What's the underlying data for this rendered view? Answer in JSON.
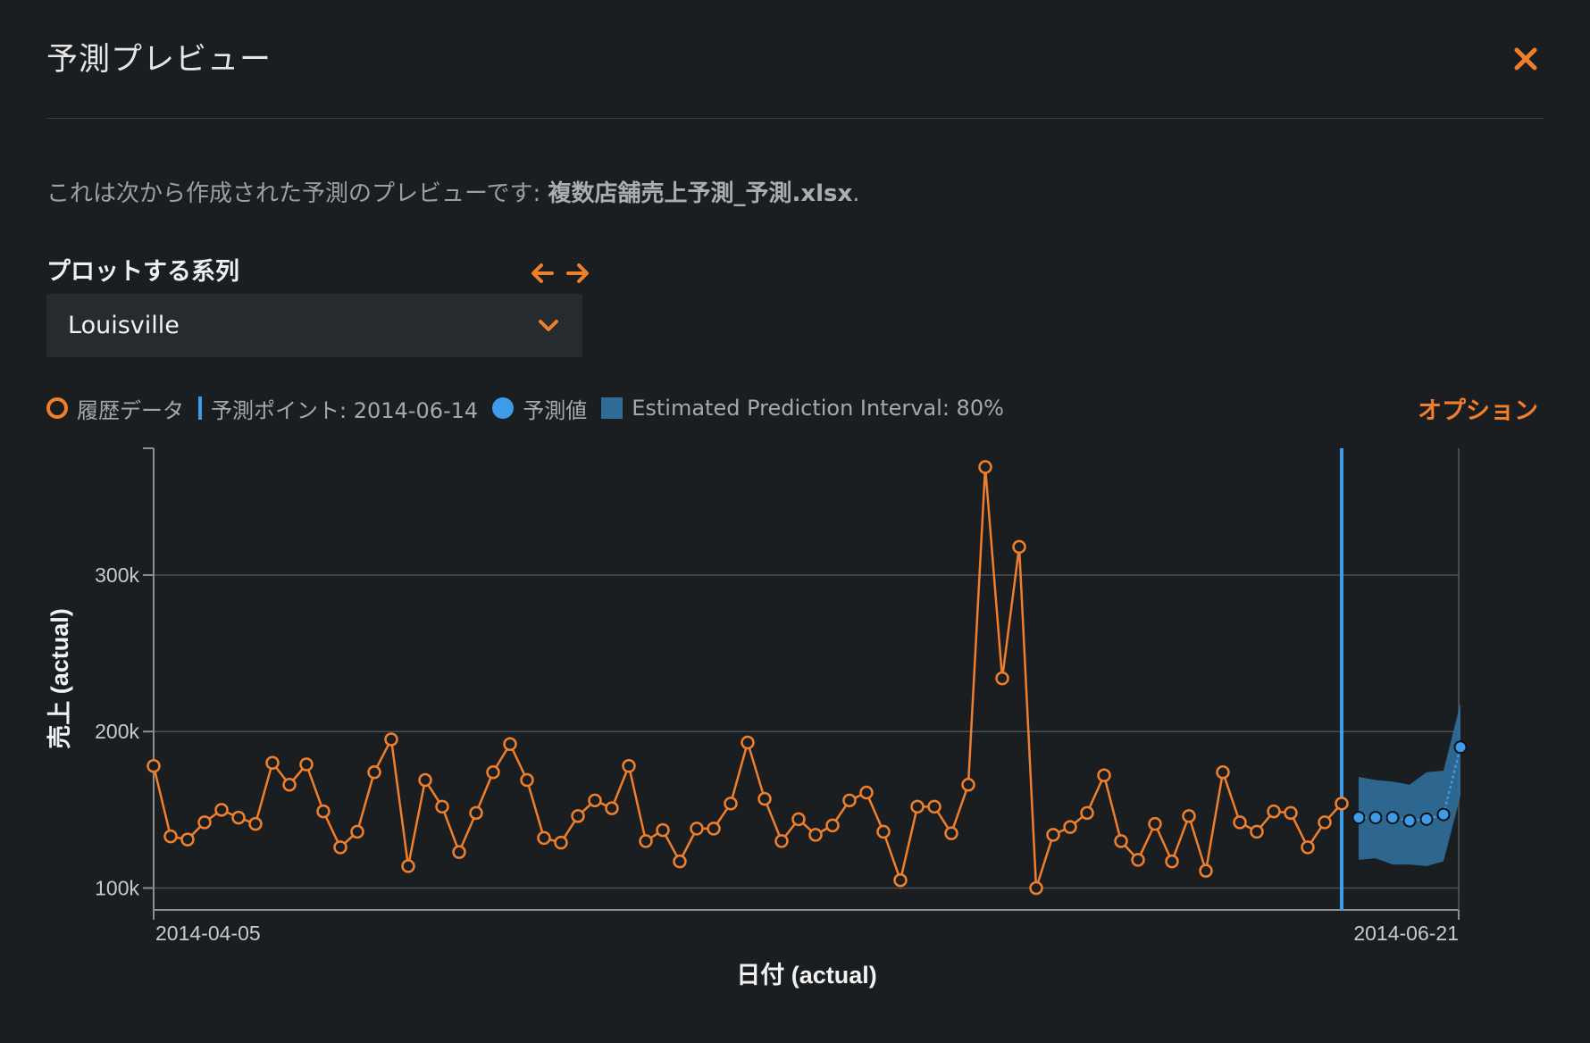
{
  "dialog": {
    "title": "予測プレビュー",
    "description_prefix": "これは次から作成された予測のプレビューです: ",
    "description_file": "複数店舗売上予測_予測.xlsx",
    "description_suffix": "."
  },
  "series_selector": {
    "label": "プロットする系列",
    "selected": "Louisville"
  },
  "legend": {
    "historical": "履歴データ",
    "forecast_point": "予測ポイント: 2014-06-14",
    "predicted": "予測値",
    "interval": "Estimated Prediction Interval: 80%"
  },
  "options_label": "オプション",
  "colors": {
    "historical": "#f07f2c",
    "predicted": "#3d9be9",
    "interval": "#2e6b97",
    "accent": "#f07f2c",
    "background": "#1a1e21"
  },
  "chart_data": {
    "type": "line",
    "xlabel": "日付 (actual)",
    "ylabel": "売上 (actual)",
    "x_ticks": [
      "2014-04-05",
      "2014-06-21"
    ],
    "y_ticks": [
      "100k",
      "200k",
      "300k"
    ],
    "ylim": [
      86000,
      381000
    ],
    "grid": true,
    "forecast_point": "2014-06-14",
    "series": [
      {
        "name": "履歴データ",
        "start_date": "2014-04-05",
        "values": [
          178000,
          133000,
          131000,
          142000,
          150000,
          145000,
          141000,
          180000,
          166000,
          179000,
          149000,
          126000,
          136000,
          174000,
          195000,
          114000,
          169000,
          152000,
          123000,
          148000,
          174000,
          192000,
          169000,
          132000,
          129000,
          146000,
          156000,
          151000,
          178000,
          130000,
          137000,
          117000,
          138000,
          138000,
          154000,
          193000,
          157000,
          130000,
          144000,
          134000,
          140000,
          156000,
          161000,
          136000,
          105000,
          152000,
          152000,
          135000,
          166000,
          369000,
          234000,
          318000,
          100000,
          134000,
          139000,
          148000,
          172000,
          130000,
          118000,
          141000,
          117000,
          146000,
          111000,
          174000,
          142000,
          136000,
          149000,
          148000,
          126000,
          142000,
          154000
        ]
      },
      {
        "name": "予測値",
        "start_date": "2014-06-15",
        "values": [
          145000,
          145000,
          145000,
          143000,
          144000,
          147000,
          190000
        ],
        "interval_lower": [
          118000,
          119000,
          115000,
          115000,
          114000,
          117000,
          159000
        ],
        "interval_upper": [
          171000,
          169000,
          168000,
          166000,
          174000,
          175000,
          218000
        ]
      }
    ]
  }
}
